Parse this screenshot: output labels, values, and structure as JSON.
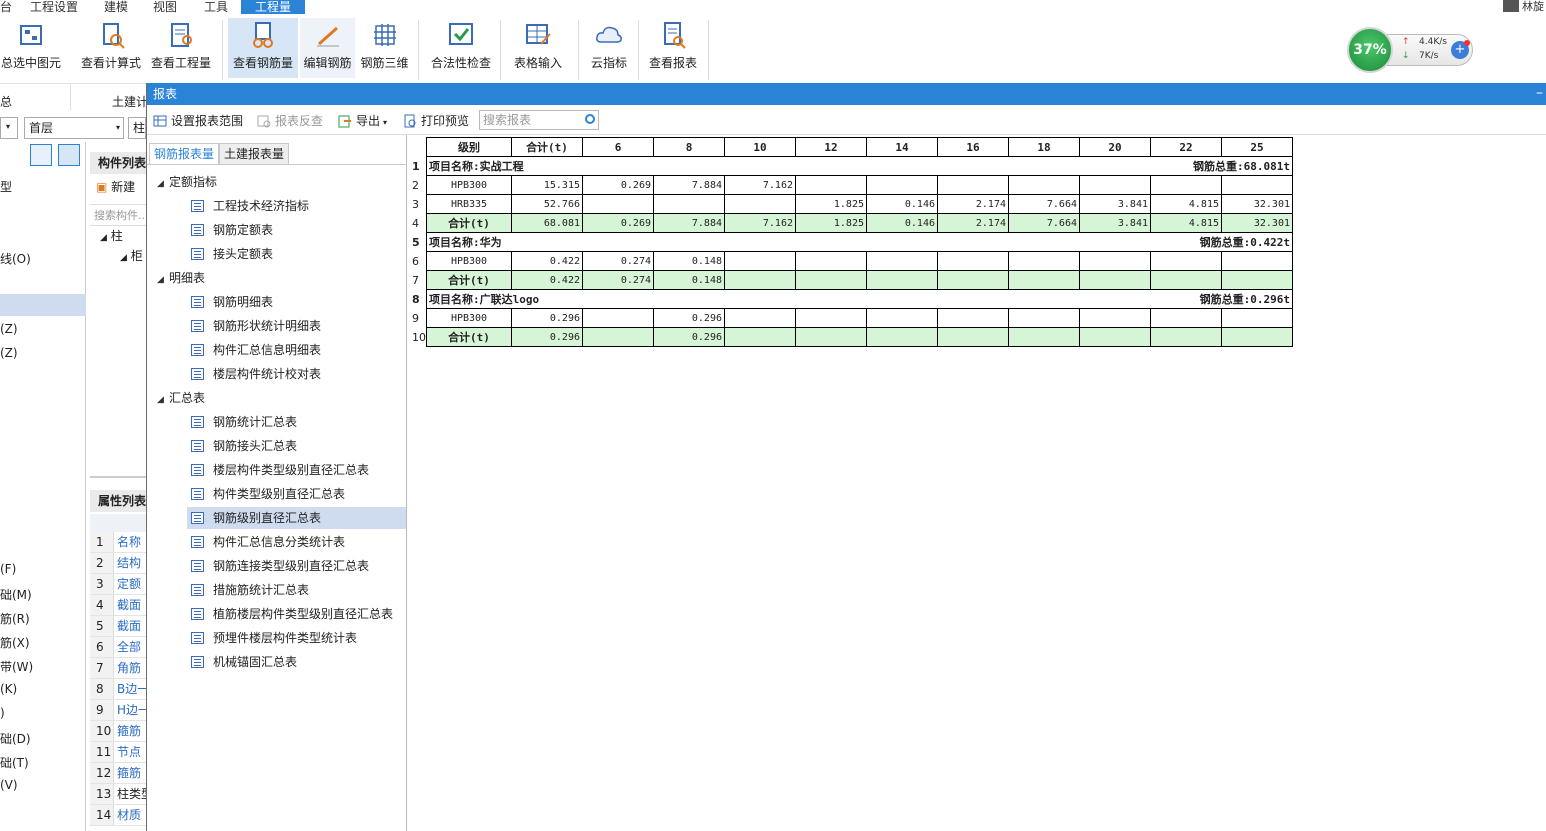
{
  "menubar": {
    "items": [
      "台",
      "工程设置",
      "建模",
      "视图",
      "工具",
      "工程量"
    ],
    "user": "林旋"
  },
  "ribbon": {
    "buttons": [
      "总选中图元",
      "查看计算式",
      "查看工程量",
      "查看钢筋量",
      "编辑钢筋",
      "钢筋三维",
      "合法性检查",
      "表格输入",
      "云指标",
      "查看报表"
    ],
    "group_left": "总",
    "group_tujian": "土建计"
  },
  "speed": {
    "percent": "37%",
    "up": "4.4K/s",
    "down": "7K/s"
  },
  "background": {
    "floor": "首层",
    "col": "柱",
    "comp_list_title": "构件列表",
    "new_label": "新建",
    "search_comp": "搜索构件...",
    "tree_col": "柱",
    "tree_sub": "柜",
    "prop_title": "属性列表",
    "prop_rows": [
      {
        "n": "1",
        "v": "名称"
      },
      {
        "n": "2",
        "v": "结构"
      },
      {
        "n": "3",
        "v": "定额"
      },
      {
        "n": "4",
        "v": "截面"
      },
      {
        "n": "5",
        "v": "截面"
      },
      {
        "n": "6",
        "v": "全部"
      },
      {
        "n": "7",
        "v": "角筋"
      },
      {
        "n": "8",
        "v": "B边一"
      },
      {
        "n": "9",
        "v": "H边一"
      },
      {
        "n": "10",
        "v": "箍筋"
      },
      {
        "n": "11",
        "v": "节点"
      },
      {
        "n": "12",
        "v": "箍筋"
      },
      {
        "n": "13",
        "v": "柱类型"
      },
      {
        "n": "14",
        "v": "材质"
      }
    ],
    "left_items": [
      "型",
      "线(O)",
      "(Z)",
      "(Z)",
      "(F)",
      "础(M)",
      "筋(R)",
      "筋(X)",
      "带(W)",
      "(K)",
      ")",
      "础(D)",
      "础(T)",
      "(V)"
    ]
  },
  "dialog": {
    "title": "报表",
    "toolbar": {
      "set_range": "设置报表范围",
      "reverse": "报表反查",
      "export": "导出",
      "print_preview": "打印预览",
      "search_placeholder": "搜索报表"
    },
    "tabs": [
      "钢筋报表量",
      "土建报表量"
    ],
    "tree": [
      {
        "group": "定额指标",
        "items": [
          "工程技术经济指标",
          "钢筋定额表",
          "接头定额表"
        ]
      },
      {
        "group": "明细表",
        "items": [
          "钢筋明细表",
          "钢筋形状统计明细表",
          "构件汇总信息明细表",
          "楼层构件统计校对表"
        ]
      },
      {
        "group": "汇总表",
        "items": [
          "钢筋统计汇总表",
          "钢筋接头汇总表",
          "楼层构件类型级别直径汇总表",
          "构件类型级别直径汇总表",
          "钢筋级别直径汇总表",
          "构件汇总信息分类统计表",
          "钢筋连接类型级别直径汇总表",
          "措施筋统计汇总表",
          "植筋楼层构件类型级别直径汇总表",
          "预埋件楼层构件类型统计表",
          "机械锚固汇总表"
        ]
      }
    ],
    "selected_item": "钢筋级别直径汇总表"
  },
  "report": {
    "header": [
      "级别",
      "合计(t)",
      "6",
      "8",
      "10",
      "12",
      "14",
      "16",
      "18",
      "20",
      "22",
      "25"
    ],
    "rows": [
      {
        "rn": "1",
        "type": "proj",
        "name": "项目名称:实战工程",
        "total": "钢筋总重:68.081t"
      },
      {
        "rn": "2",
        "type": "data",
        "cells": [
          "HPB300",
          "15.315",
          "0.269",
          "7.884",
          "7.162",
          "",
          "",
          "",
          "",
          "",
          "",
          ""
        ]
      },
      {
        "rn": "3",
        "type": "data",
        "cells": [
          "HRB335",
          "52.766",
          "",
          "",
          "",
          "1.825",
          "0.146",
          "2.174",
          "7.664",
          "3.841",
          "4.815",
          "32.301"
        ]
      },
      {
        "rn": "4",
        "type": "sum",
        "cells": [
          "合计(t)",
          "68.081",
          "0.269",
          "7.884",
          "7.162",
          "1.825",
          "0.146",
          "2.174",
          "7.664",
          "3.841",
          "4.815",
          "32.301"
        ]
      },
      {
        "rn": "5",
        "type": "proj",
        "name": "项目名称:华为",
        "total": "钢筋总重:0.422t"
      },
      {
        "rn": "6",
        "type": "data",
        "cells": [
          "HPB300",
          "0.422",
          "0.274",
          "0.148",
          "",
          "",
          "",
          "",
          "",
          "",
          "",
          ""
        ]
      },
      {
        "rn": "7",
        "type": "sum",
        "cells": [
          "合计(t)",
          "0.422",
          "0.274",
          "0.148",
          "",
          "",
          "",
          "",
          "",
          "",
          "",
          ""
        ]
      },
      {
        "rn": "8",
        "type": "proj",
        "name": "项目名称:广联达logo",
        "total": "钢筋总重:0.296t"
      },
      {
        "rn": "9",
        "type": "data",
        "cells": [
          "HPB300",
          "0.296",
          "",
          "0.296",
          "",
          "",
          "",
          "",
          "",
          "",
          "",
          ""
        ]
      },
      {
        "rn": "10",
        "type": "sum",
        "cells": [
          "合计(t)",
          "0.296",
          "",
          "0.296",
          "",
          "",
          "",
          "",
          "",
          "",
          "",
          ""
        ]
      }
    ]
  }
}
